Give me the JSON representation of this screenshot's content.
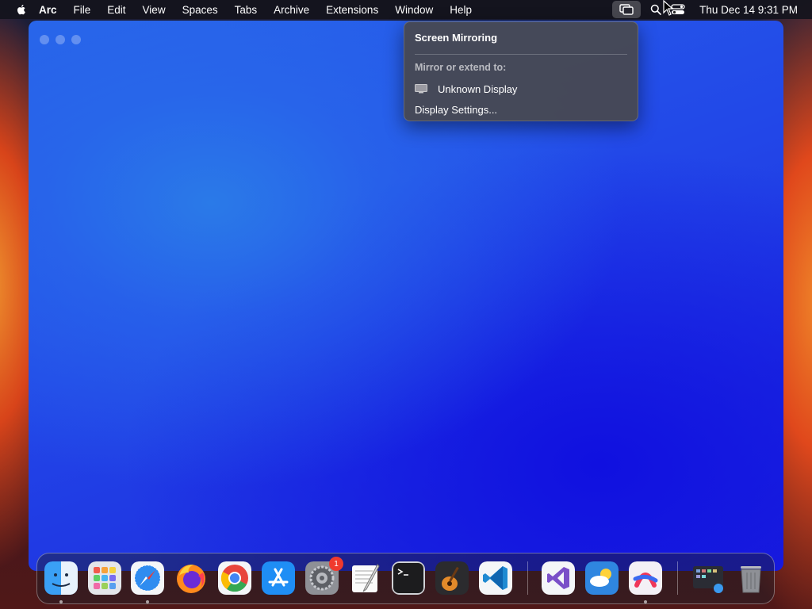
{
  "menubar": {
    "app_name": "Arc",
    "menus": [
      "File",
      "Edit",
      "View",
      "Spaces",
      "Tabs",
      "Archive",
      "Extensions",
      "Window",
      "Help"
    ],
    "clock": "Thu Dec 14  9:31 PM",
    "status_icons": [
      "screen-mirroring-icon",
      "search-icon",
      "control-center-icon"
    ]
  },
  "screen_mirroring_menu": {
    "title": "Screen Mirroring",
    "section_label": "Mirror or extend to:",
    "display_item": "Unknown Display",
    "settings_item": "Display Settings..."
  },
  "dock": {
    "apps": [
      "Finder",
      "Launchpad",
      "Safari",
      "Firefox",
      "Chrome",
      "App Store",
      "System Settings",
      "TextEdit",
      "Terminal",
      "GarageBand",
      "Visual Studio Code",
      "Visual Studio",
      "Weather",
      "Arc",
      "Screenshot",
      "Trash"
    ],
    "system_settings_badge": "1"
  },
  "colors": {
    "window_gradient_top": "#2a7ae8",
    "window_gradient_bottom": "#1c22dc",
    "menu_bg": "#48484e",
    "badge": "#f03a2e"
  }
}
